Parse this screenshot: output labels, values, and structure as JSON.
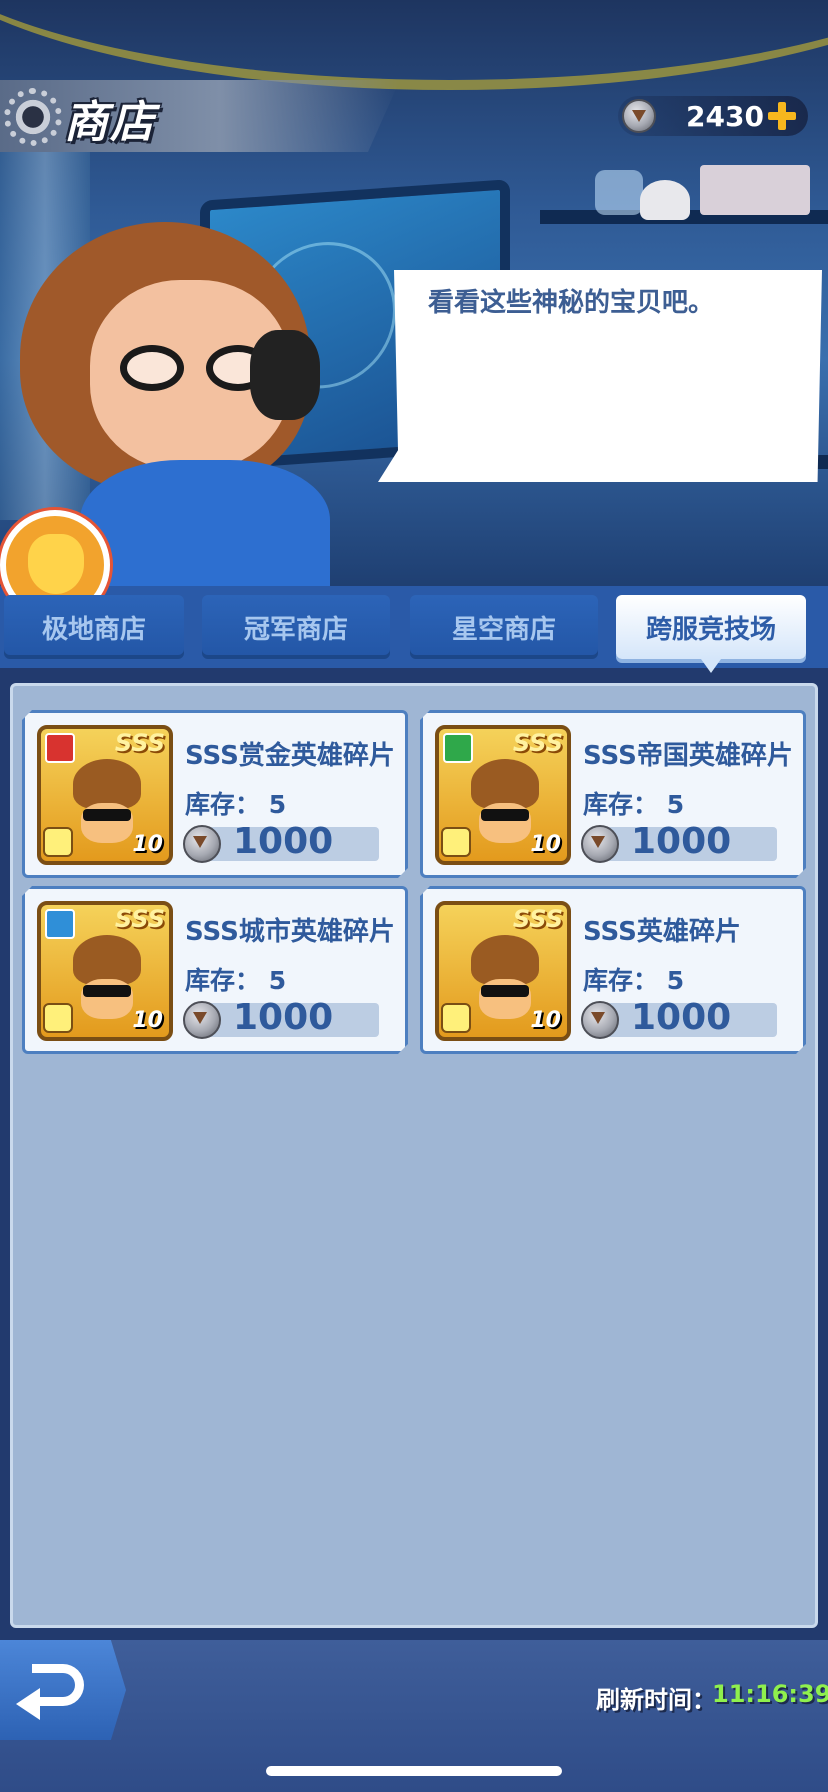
{
  "header": {
    "title": "商店",
    "currency_amount": "2430"
  },
  "npc": {
    "speech": "看看这些神秘的宝贝吧。"
  },
  "tabs": [
    {
      "label": "极地商店",
      "active": false
    },
    {
      "label": "冠军商店",
      "active": false
    },
    {
      "label": "星空商店",
      "active": false
    },
    {
      "label": "跨服竞技场",
      "active": true
    }
  ],
  "items": [
    {
      "name": "SSS赏金英雄碎片",
      "stock": "库存： 5",
      "price": "1000",
      "grade": "SSS",
      "count": "10",
      "faction_color": "#d8332f"
    },
    {
      "name": "SSS帝国英雄碎片",
      "stock": "库存： 5",
      "price": "1000",
      "grade": "SSS",
      "count": "10",
      "faction_color": "#2fa84a"
    },
    {
      "name": "SSS城市英雄碎片",
      "stock": "库存： 5",
      "price": "1000",
      "grade": "SSS",
      "count": "10",
      "faction_color": "#2f8fd8"
    },
    {
      "name": "SSS英雄碎片",
      "stock": "库存： 5",
      "price": "1000",
      "grade": "SSS",
      "count": "10",
      "faction_color": ""
    }
  ],
  "footer": {
    "refresh_label": "刷新时间：",
    "refresh_time": "11:16:39"
  },
  "colors": {
    "accent": "#2f5a9c",
    "tab_active": "#ffffff",
    "timer": "#8ff04d"
  }
}
